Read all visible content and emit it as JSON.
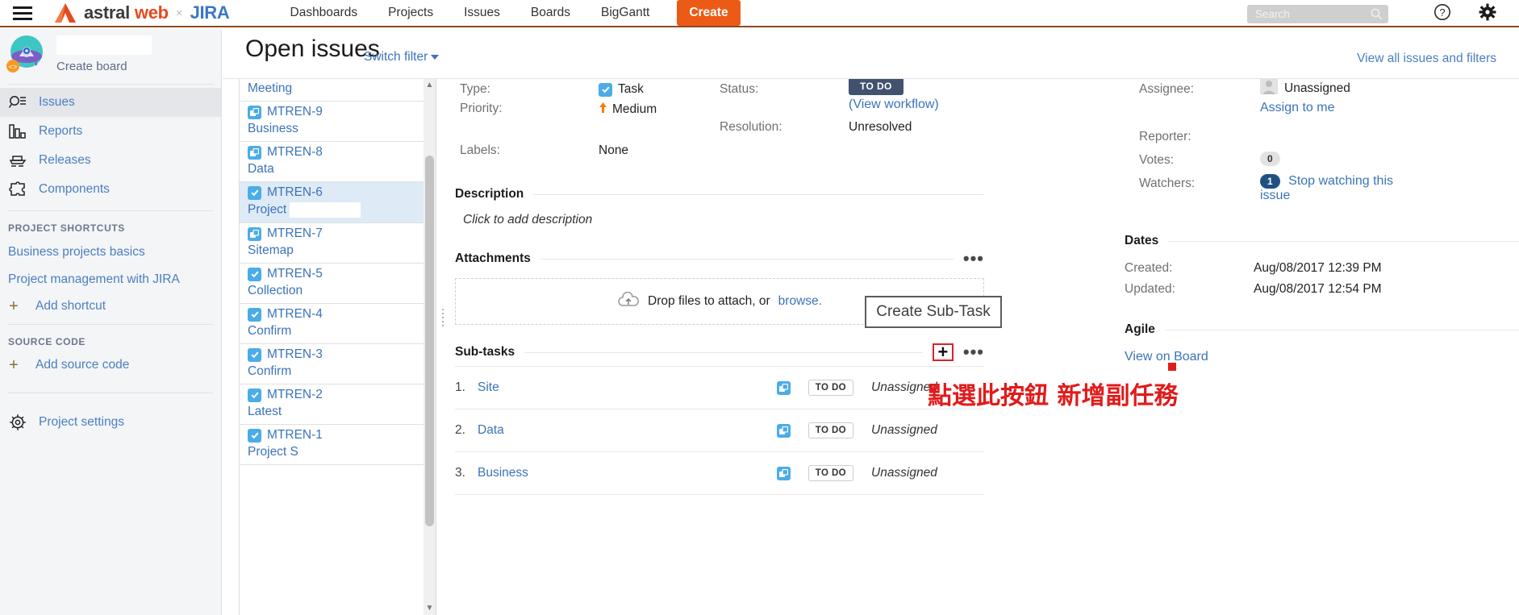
{
  "topnav": {
    "menu_icon": "hamburger-icon",
    "brand": {
      "astral": "astral",
      "web": "web",
      "separator": "×",
      "jira": "JIRA"
    },
    "links": [
      "Dashboards",
      "Projects",
      "Issues",
      "Boards",
      "BigGantt"
    ],
    "create_label": "Create",
    "search": {
      "placeholder": "Search",
      "value": "",
      "icon": "search-icon"
    },
    "help_icon": "help-icon",
    "settings_icon": "gear-icon"
  },
  "sidebar": {
    "project_name": "",
    "create_board_label": "Create board",
    "nav": [
      {
        "label": "Issues",
        "icon": "issues-icon",
        "active": true
      },
      {
        "label": "Reports",
        "icon": "reports-icon",
        "active": false
      },
      {
        "label": "Releases",
        "icon": "releases-icon",
        "active": false
      },
      {
        "label": "Components",
        "icon": "components-icon",
        "active": false
      }
    ],
    "shortcuts_heading": "PROJECT SHORTCUTS",
    "shortcuts": [
      "Business projects basics",
      "Project management with JIRA"
    ],
    "add_shortcut_label": "Add shortcut",
    "source_code_heading": "SOURCE CODE",
    "add_source_code_label": "Add source code",
    "project_settings_label": "Project settings"
  },
  "page": {
    "title": "Open issues",
    "switch_filter_label": "Switch filter",
    "view_all_label": "View all issues and filters"
  },
  "issue_list": [
    {
      "key": "",
      "summary": "Meeting",
      "type": "sub-task",
      "selected": false,
      "partial": true
    },
    {
      "key": "MTREN-9",
      "summary": "Business",
      "type": "sub-task",
      "selected": false
    },
    {
      "key": "MTREN-8",
      "summary": "Data",
      "type": "sub-task",
      "selected": false
    },
    {
      "key": "MTREN-6",
      "summary": "Project",
      "type": "task",
      "selected": true,
      "redacted": true
    },
    {
      "key": "MTREN-7",
      "summary": "Sitemap",
      "type": "sub-task",
      "selected": false
    },
    {
      "key": "MTREN-5",
      "summary": "Collection",
      "type": "task",
      "selected": false
    },
    {
      "key": "MTREN-4",
      "summary": "Confirm",
      "type": "task",
      "selected": false
    },
    {
      "key": "MTREN-3",
      "summary": "Confirm",
      "type": "task",
      "selected": false
    },
    {
      "key": "MTREN-2",
      "summary": "Latest",
      "type": "task",
      "selected": false
    },
    {
      "key": "MTREN-1",
      "summary": "Project S",
      "type": "task",
      "selected": false
    }
  ],
  "detail": {
    "type_label": "Type:",
    "type_value": "Task",
    "priority_label": "Priority:",
    "priority_value": "Medium",
    "priority_icon": "priority-medium-arrow-icon",
    "labels_label": "Labels:",
    "labels_value": "None",
    "status_label": "Status:",
    "status_value": "TO DO",
    "view_workflow_label": "(View workflow)",
    "resolution_label": "Resolution:",
    "resolution_value": "Unresolved",
    "assignee_label": "Assignee:",
    "assignee_value": "Unassigned",
    "assign_to_me_label": "Assign to me",
    "reporter_label": "Reporter:",
    "reporter_value": "",
    "votes_label": "Votes:",
    "votes_value": "0",
    "watchers_label": "Watchers:",
    "watchers_value": "1",
    "watchers_link": "Stop watching this issue",
    "description_heading": "Description",
    "description_placeholder": "Click to add description",
    "attachments_heading": "Attachments",
    "attachments_menu": "•••",
    "dropzone_text": "Drop files to attach, or",
    "dropzone_link": "browse.",
    "subtasks_heading": "Sub-tasks",
    "subtasks_add": "+",
    "subtasks_menu": "•••",
    "subtasks": [
      {
        "num": "1.",
        "name": "Site",
        "status": "TO DO",
        "assignee": "Unassigned"
      },
      {
        "num": "2.",
        "name": "Data",
        "status": "TO DO",
        "assignee": "Unassigned"
      },
      {
        "num": "3.",
        "name": "Business",
        "status": "TO DO",
        "assignee": "Unassigned"
      }
    ],
    "dates_heading": "Dates",
    "created_label": "Created:",
    "created_value": "Aug/08/2017 12:39 PM",
    "updated_label": "Updated:",
    "updated_value": "Aug/08/2017 12:54 PM",
    "agile_heading": "Agile",
    "view_on_board_label": "View on Board"
  },
  "annotations": {
    "tooltip_text": "Create Sub-Task",
    "callout_text": "點選此按鈕 新增副任務"
  },
  "colors": {
    "brand_orange": "#e8491d",
    "create_orange": "#ec5b16",
    "link_blue": "#3b73b9",
    "status_navy": "#42526e",
    "annotation_red": "#e01b1b",
    "selected_row": "#deebf7",
    "sidebar_bg": "#f4f5f7"
  }
}
